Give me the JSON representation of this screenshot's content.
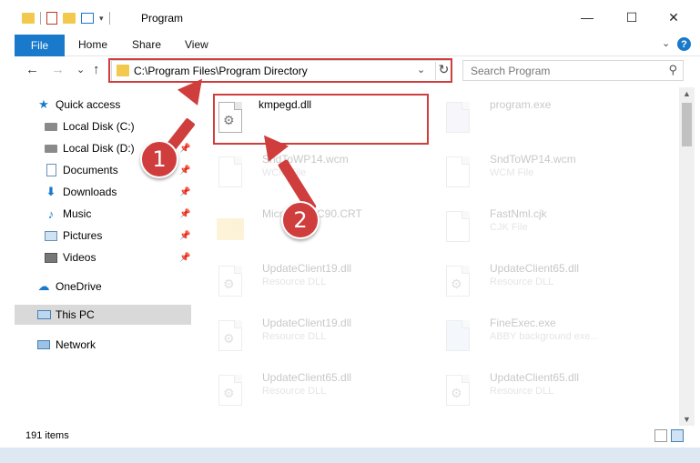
{
  "window": {
    "title": "Program",
    "minimize_glyph": "—",
    "maximize_glyph": "☐",
    "close_glyph": "✕"
  },
  "ribbon": {
    "tabs": [
      "File",
      "Home",
      "Share",
      "View"
    ],
    "help_glyph": "?",
    "expand_glyph": "⌄"
  },
  "nav": {
    "back_glyph": "←",
    "forward_glyph": "→",
    "recent_glyph": "⌄",
    "up_glyph": "↑",
    "address": "C:\\Program Files\\Program Directory",
    "address_drop_glyph": "⌄",
    "refresh_glyph": "↻",
    "search_placeholder": "Search Program",
    "search_glyph": "⚲"
  },
  "sidebar": {
    "quick_access": "Quick access",
    "items": [
      {
        "label": "Local Disk (C:)",
        "icon": "drive-icon"
      },
      {
        "label": "Local Disk (D:)",
        "icon": "drive-icon"
      },
      {
        "label": "Documents",
        "icon": "documents-icon"
      },
      {
        "label": "Downloads",
        "icon": "downloads-icon"
      },
      {
        "label": "Music",
        "icon": "music-icon"
      },
      {
        "label": "Pictures",
        "icon": "pictures-icon"
      },
      {
        "label": "Videos",
        "icon": "videos-icon"
      }
    ],
    "onedrive": "OneDrive",
    "this_pc": "This PC",
    "network": "Network"
  },
  "files": [
    {
      "name": "kmpegd.dll",
      "type": "",
      "faded": false
    },
    {
      "name": "program.exe",
      "type": "",
      "faded": true
    },
    {
      "name": "SndToWP14.wcm",
      "type": "WCM File",
      "faded": true
    },
    {
      "name": "SndToWP14.wcm",
      "type": "WCM File",
      "faded": true
    },
    {
      "name": "Microsoft.VC90.CRT",
      "type": "",
      "faded": true
    },
    {
      "name": "FastNml.cjk",
      "type": "CJK File",
      "faded": true
    },
    {
      "name": "UpdateClient19.dll",
      "type": "Resource DLL",
      "faded": true
    },
    {
      "name": "UpdateClient65.dll",
      "type": "Resource DLL",
      "faded": true
    },
    {
      "name": "UpdateClient19.dll",
      "type": "Resource DLL",
      "faded": true
    },
    {
      "name": "FineExec.exe",
      "type": "ABBY background exe...",
      "faded": true
    },
    {
      "name": "UpdateClient65.dll",
      "type": "Resource DLL",
      "faded": true
    },
    {
      "name": "UpdateClient65.dll",
      "type": "Resource DLL",
      "faded": true
    }
  ],
  "status": {
    "item_count": "191 items"
  },
  "annotations": {
    "step1": "1",
    "step2": "2",
    "color": "#d03d3d"
  }
}
